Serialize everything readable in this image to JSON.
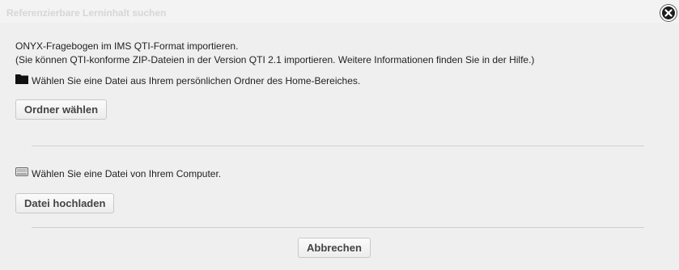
{
  "dialog": {
    "title": "Referenzierbare Lerninhalt suchen",
    "close_icon": "close-circle-icon"
  },
  "intro": {
    "line1": "ONYX-Fragebogen im IMS QTI-Format importieren.",
    "line2": "(Sie können QTI-konforme ZIP-Dateien in der Version QTI 2.1 importieren. Weitere Informationen finden Sie in der Hilfe.)"
  },
  "home_option": {
    "icon": "folder-icon",
    "text": "Wählen Sie eine Datei aus Ihrem persönlichen Ordner des Home-Bereiches.",
    "button_label": "Ordner wählen"
  },
  "computer_option": {
    "icon": "hard-drive-icon",
    "text": "Wählen Sie eine Datei von Ihrem Computer.",
    "button_label": "Datei hochladen"
  },
  "footer": {
    "cancel_label": "Abbrechen"
  },
  "colors": {
    "background": "#efefef",
    "title_text": "#d6d6d6",
    "divider": "#cfcfcf"
  }
}
